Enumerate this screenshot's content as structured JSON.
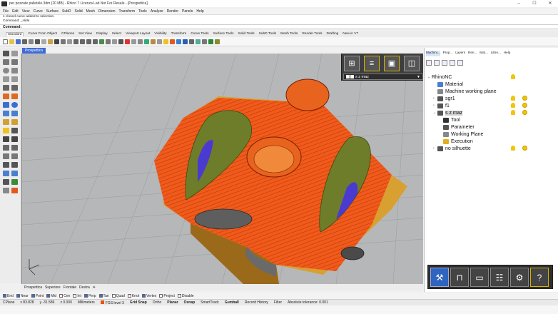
{
  "titlebar": {
    "title": "per pozzate palletele.3dm (20 MB) - Rhino 7 Licenza Lab Not For Resale - [Prospettica]",
    "minimize": "–",
    "maximize": "☐",
    "close": "✕"
  },
  "menu": [
    "File",
    "Edit",
    "View",
    "Curve",
    "Surface",
    "SubD",
    "Solid",
    "Mesh",
    "Dimension",
    "Transform",
    "Tools",
    "Analyze",
    "Render",
    "Panels",
    "Help"
  ],
  "command_history": [
    "1 closed curve added to selection.",
    "Command: _Hide"
  ],
  "command_prompt": "Command:",
  "toolbar_tabs": [
    "Standard",
    "Curve From Object",
    "CPlanes",
    "Set View",
    "Display",
    "Select",
    "Viewport Layout",
    "Visibility",
    "Transform",
    "Curve Tools",
    "Surface Tools",
    "Solid Tools",
    "SubD Tools",
    "Mesh Tools",
    "Render Tools",
    "Drafting",
    "New in V7"
  ],
  "viewport": {
    "tab_label": "Prospettica",
    "dropdown_value": "s z maz"
  },
  "viewport_tabs": [
    "Prospettica",
    "Superiore",
    "Frontale",
    "Destra"
  ],
  "osnaps": [
    {
      "label": "End",
      "checked": true
    },
    {
      "label": "Near",
      "checked": true
    },
    {
      "label": "Point",
      "checked": true
    },
    {
      "label": "Mid",
      "checked": true
    },
    {
      "label": "Cen",
      "checked": false
    },
    {
      "label": "Int",
      "checked": false
    },
    {
      "label": "Perp",
      "checked": true
    },
    {
      "label": "Tan",
      "checked": true
    },
    {
      "label": "Quad",
      "checked": false
    },
    {
      "label": "Knot",
      "checked": false
    },
    {
      "label": "Vertex",
      "checked": true
    },
    {
      "label": "Project",
      "checked": false
    },
    {
      "label": "Disable",
      "checked": false
    }
  ],
  "status": {
    "cplane": "CPlane",
    "x": "x 83.828",
    "y": "y -31.586",
    "z": "z 0.000",
    "units": "Millimeters",
    "layer": "FGS level 3",
    "layer_color": "#e85412",
    "grid_snap": "Grid Snap",
    "ortho": "Ortho",
    "planar": "Planar",
    "osnap": "Osnap",
    "smarttrack": "SmartTrack",
    "gumball": "Gumball",
    "record_history": "Record History",
    "filter": "Filter",
    "tolerance": "Absolute tolerance: 0.001"
  },
  "panel": {
    "tabs": [
      "Machini...",
      "Prop...",
      "Layers",
      "Ren...",
      "Mat...",
      "Libre...",
      "Help"
    ],
    "tree": [
      {
        "label": "RhinoNC",
        "level": 0,
        "expander": "⌄",
        "icon": "",
        "bulb": true,
        "dot": false,
        "selected": false
      },
      {
        "label": "Material",
        "level": 1,
        "expander": "",
        "icon": "material-icon",
        "bulb": false,
        "dot": false,
        "selected": false
      },
      {
        "label": "Machine working plane",
        "level": 1,
        "expander": "",
        "icon": "plane-icon",
        "bulb": false,
        "dot": false,
        "selected": false
      },
      {
        "label": "sgr1",
        "level": 1,
        "expander": "›",
        "icon": "job-icon",
        "bulb": true,
        "dot": true,
        "selected": false
      },
      {
        "label": "f1",
        "level": 1,
        "expander": "›",
        "icon": "job-icon",
        "bulb": true,
        "dot": true,
        "selected": false
      },
      {
        "label": "s z maz",
        "level": 1,
        "expander": "⌄",
        "icon": "job-icon",
        "bulb": true,
        "dot": true,
        "selected": true
      },
      {
        "label": "Tool",
        "level": 2,
        "expander": "",
        "icon": "tool-icon",
        "bulb": false,
        "dot": false,
        "selected": false
      },
      {
        "label": "Parameter",
        "level": 2,
        "expander": "",
        "icon": "parameter-icon",
        "bulb": false,
        "dot": false,
        "selected": false
      },
      {
        "label": "Working Plane",
        "level": 2,
        "expander": "",
        "icon": "plane-icon",
        "bulb": false,
        "dot": false,
        "selected": false
      },
      {
        "label": "Execution",
        "level": 2,
        "expander": "",
        "icon": "execution-icon",
        "bulb": false,
        "dot": false,
        "selected": false
      },
      {
        "label": "no silhuette",
        "level": 1,
        "expander": "›",
        "icon": "job-icon",
        "bulb": true,
        "dot": true,
        "selected": false
      }
    ],
    "bottom_buttons": [
      "machine-icon",
      "tool-holder-icon",
      "stock-icon",
      "cabinet-icon",
      "gears-icon",
      "help-icon"
    ],
    "help_symbol": "?"
  }
}
